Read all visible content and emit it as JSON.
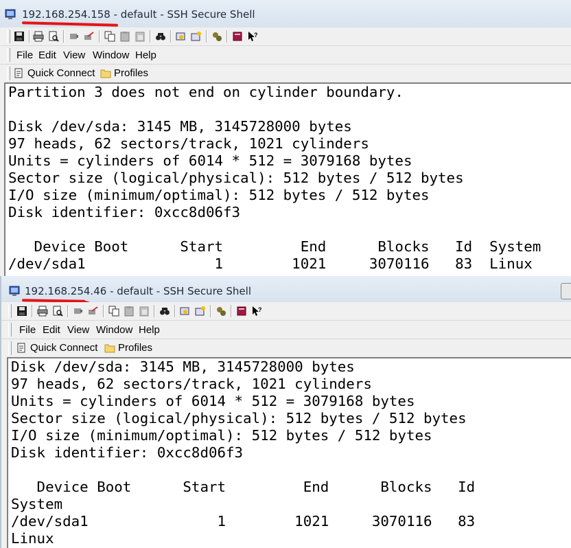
{
  "windows": [
    {
      "title_ip": "192.168.254.158",
      "title_rest": " - default - SSH Secure Shell",
      "menu": [
        "File",
        "Edit",
        "View",
        "Window",
        "Help"
      ],
      "quick_connect": "Quick Connect",
      "profiles": "Profiles",
      "terminal_lines": [
        "Partition 3 does not end on cylinder boundary.",
        "",
        "Disk /dev/sda: 3145 MB, 3145728000 bytes",
        "97 heads, 62 sectors/track, 1021 cylinders",
        "Units = cylinders of 6014 * 512 = 3079168 bytes",
        "Sector size (logical/physical): 512 bytes / 512 bytes",
        "I/O size (minimum/optimal): 512 bytes / 512 bytes",
        "Disk identifier: 0xcc8d06f3",
        "",
        "   Device Boot      Start         End      Blocks   Id  System",
        "/dev/sda1               1        1021     3070116   83  Linux"
      ]
    },
    {
      "title_ip": "192.168.254.46",
      "title_rest": " - default - SSH Secure Shell",
      "menu": [
        "File",
        "Edit",
        "View",
        "Window",
        "Help"
      ],
      "quick_connect": "Quick Connect",
      "profiles": "Profiles",
      "terminal_lines": [
        "Disk /dev/sda: 3145 MB, 3145728000 bytes",
        "97 heads, 62 sectors/track, 1021 cylinders",
        "Units = cylinders of 6014 * 512 = 3079168 bytes",
        "Sector size (logical/physical): 512 bytes / 512 bytes",
        "I/O size (minimum/optimal): 512 bytes / 512 bytes",
        "Disk identifier: 0xcc8d06f3",
        "",
        "   Device Boot      Start         End      Blocks   Id",
        "System",
        "/dev/sda1               1        1021     3070116   83",
        "Linux"
      ]
    }
  ],
  "colors": {
    "annotation_underline": "#e41515",
    "title_text": "#1e2a3a",
    "terminal_bg": "#ffffff"
  },
  "icons": [
    "save-icon",
    "print-icon",
    "print-preview-icon",
    "disconnect-icon",
    "connect-icon",
    "copy-icon",
    "paste-icon",
    "paste-special-icon",
    "find-icon",
    "settings-icon",
    "new-window-icon",
    "file-transfer-icon",
    "help-book-icon",
    "whats-this-icon"
  ]
}
